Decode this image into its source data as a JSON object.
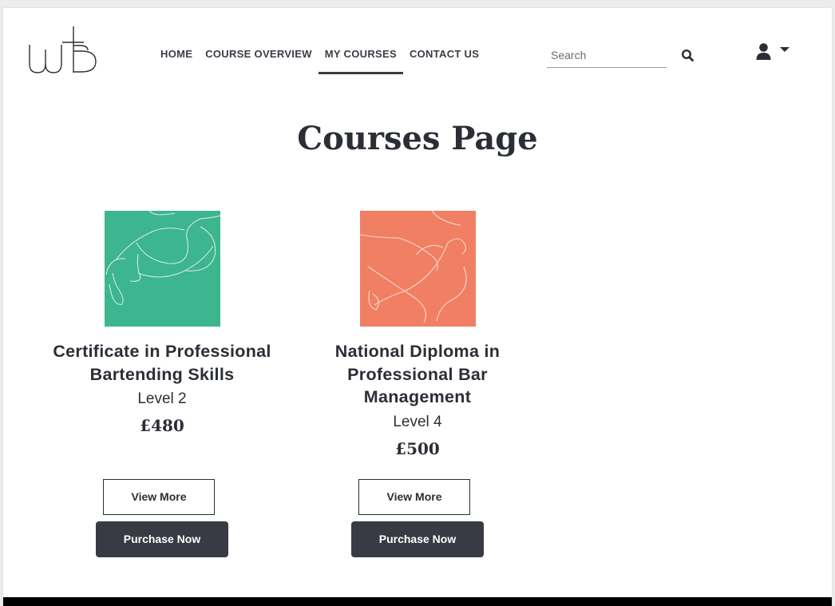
{
  "nav": {
    "items": [
      {
        "label": "HOME",
        "active": false
      },
      {
        "label": "COURSE OVERVIEW",
        "active": false
      },
      {
        "label": "MY COURSES",
        "active": true
      },
      {
        "label": "CONTACT US",
        "active": false
      }
    ]
  },
  "search": {
    "placeholder": "Search",
    "value": "",
    "icon": "search-icon"
  },
  "user_menu": {
    "icon": "user-icon",
    "dropdown_icon": "caret-down-icon"
  },
  "page": {
    "heading": "Courses Page"
  },
  "courses": [
    {
      "title": "Certificate in Professional Bartending Skills",
      "level": "Level 2",
      "price": "£480",
      "thumb_color": "#3db58f",
      "view_label": "View More",
      "buy_label": "Purchase Now"
    },
    {
      "title": "National Diploma in Professional Bar Management",
      "level": "Level 4",
      "price": "£500",
      "thumb_color": "#f07f63",
      "view_label": "View More",
      "buy_label": "Purchase Now"
    }
  ],
  "colors": {
    "text": "#2b2e36",
    "button_dark": "#383b43",
    "footer": "#000000"
  }
}
